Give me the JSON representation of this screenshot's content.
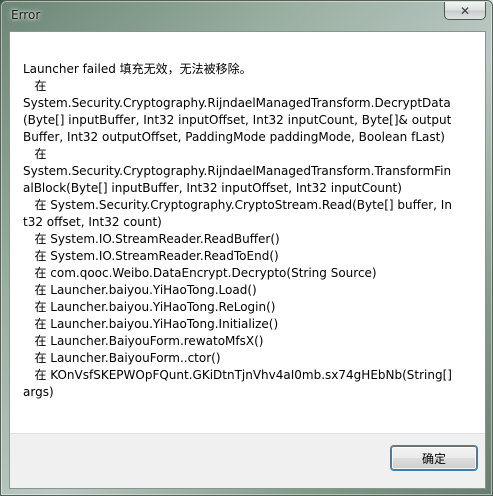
{
  "window": {
    "title": "Error",
    "close_label": "✕"
  },
  "message": {
    "lines": [
      "Launcher failed 填充无效，无法被移除。",
      "   在",
      "System.Security.Cryptography.RijndaelManagedTransform.DecryptData(Byte[] inputBuffer, Int32 inputOffset, Int32 inputCount, Byte[]& outputBuffer, Int32 outputOffset, PaddingMode paddingMode, Boolean fLast)",
      "   在",
      "System.Security.Cryptography.RijndaelManagedTransform.TransformFinalBlock(Byte[] inputBuffer, Int32 inputOffset, Int32 inputCount)",
      "   在 System.Security.Cryptography.CryptoStream.Read(Byte[] buffer, Int32 offset, Int32 count)",
      "   在 System.IO.StreamReader.ReadBuffer()",
      "   在 System.IO.StreamReader.ReadToEnd()",
      "   在 com.qooc.Weibo.DataEncrypt.Decrypto(String Source)",
      "   在 Launcher.baiyou.YiHaoTong.Load()",
      "   在 Launcher.baiyou.YiHaoTong.ReLogin()",
      "   在 Launcher.baiyou.YiHaoTong.Initialize()",
      "   在 Launcher.BaiyouForm.rewatoMfsX()",
      "   在 Launcher.BaiyouForm..ctor()",
      "   在 KOnVsfSKEPWOpFQunt.GKiDtnTjnVhv4aI0mb.sx74gHEbNb(String[] args)"
    ]
  },
  "buttons": {
    "ok_label": "确定"
  }
}
